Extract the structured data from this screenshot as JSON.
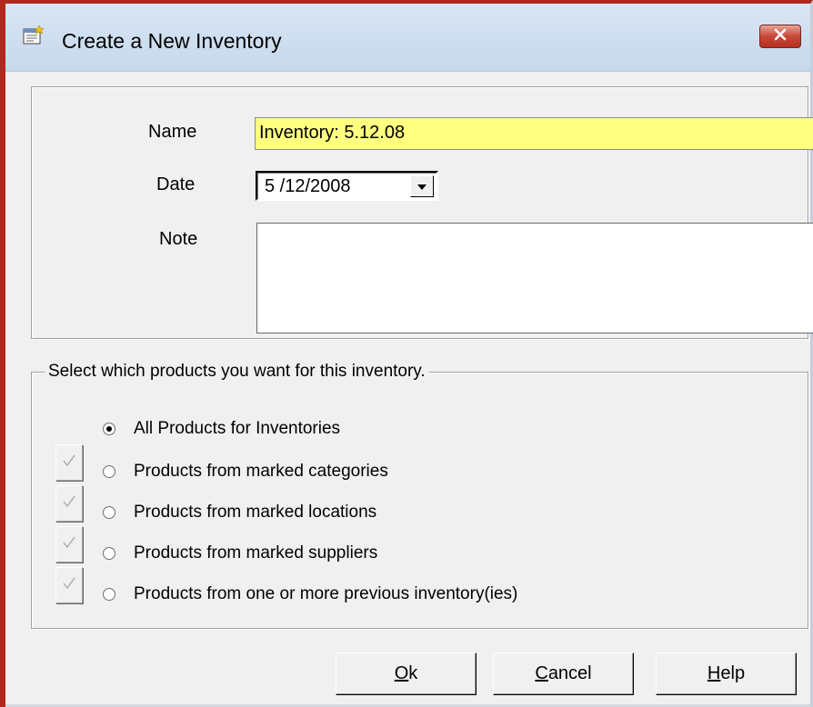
{
  "window": {
    "title": "Create a New Inventory"
  },
  "form": {
    "name_label": "Name",
    "name_value": "Inventory: 5.12.08",
    "date_label": "Date",
    "date_value": "5 /12/2008",
    "note_label": "Note",
    "note_value": ""
  },
  "products": {
    "legend": "Select which products you want for this inventory.",
    "options": [
      {
        "label": "All Products for Inventories",
        "selected": true
      },
      {
        "label": "Products from marked categories",
        "selected": false
      },
      {
        "label": "Products from marked locations",
        "selected": false
      },
      {
        "label": "Products from marked suppliers",
        "selected": false
      },
      {
        "label": "Products from one or more previous inventory(ies)",
        "selected": false
      }
    ]
  },
  "buttons": {
    "ok": {
      "accel": "O",
      "rest": "k"
    },
    "cancel": {
      "accel": "C",
      "rest": "ancel"
    },
    "help": {
      "accel": "H",
      "rest": "elp"
    }
  },
  "colors": {
    "name_highlight": "#ffff80",
    "window_border": "#b0281e"
  },
  "icons": {
    "title": "new-document-icon",
    "close": "close-icon",
    "dropdown": "chevron-down-icon",
    "mark": "checkmark-icon"
  }
}
